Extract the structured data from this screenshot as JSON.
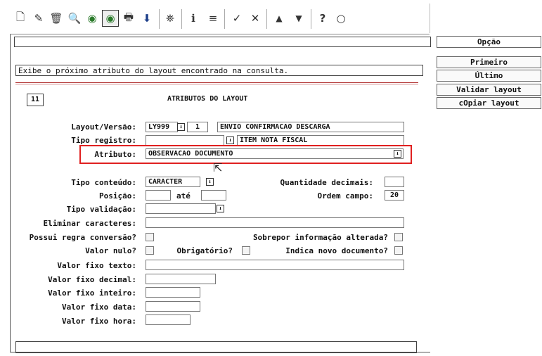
{
  "toolbar": {
    "buttons": [
      {
        "name": "new-icon",
        "glyph": "🗋"
      },
      {
        "name": "edit-icon",
        "glyph": "✎"
      },
      {
        "name": "delete-icon",
        "glyph": "🗑"
      },
      {
        "name": "search-icon",
        "glyph": "🔍"
      },
      {
        "name": "previous-icon",
        "glyph": "◉"
      },
      {
        "name": "next-icon",
        "glyph": "◉"
      },
      {
        "name": "print-icon",
        "glyph": "🖶"
      },
      {
        "name": "export-icon",
        "glyph": "⬇"
      },
      {
        "name": "binoculars-icon",
        "glyph": "⛯"
      },
      {
        "name": "info-icon",
        "glyph": "ℹ"
      },
      {
        "name": "list-icon",
        "glyph": "≡"
      },
      {
        "name": "confirm-icon",
        "glyph": "✓"
      },
      {
        "name": "cancel-icon",
        "glyph": "✕"
      },
      {
        "name": "up-icon",
        "glyph": "▲"
      },
      {
        "name": "down-icon",
        "glyph": "▼"
      },
      {
        "name": "help-icon",
        "glyph": "?"
      },
      {
        "name": "chat-icon",
        "glyph": "○"
      }
    ]
  },
  "message": "Exibe o próximo atributo do layout encontrado na consulta.",
  "form": {
    "record_number": "11",
    "title": "ATRIBUTOS DO LAYOUT",
    "layout_label": "Layout/Versão:",
    "layout_code": "LY999",
    "layout_version": "1",
    "layout_desc": "ENVIO CONFIRMACAO DESCARGA",
    "tipo_registro_label": "Tipo registro:",
    "tipo_registro_code": "",
    "tipo_registro_desc": "ITEM NOTA FISCAL",
    "atributo_label": "Atributo:",
    "atributo_value": "OBSERVACAO DOCUMENTO",
    "tipo_conteudo_label": "Tipo conteúdo:",
    "tipo_conteudo_value": "CARACTER",
    "quantidade_decimais_label": "Quantidade decimais:",
    "quantidade_decimais_value": "",
    "posicao_label": "Posição:",
    "posicao_from": "",
    "ate_label": "até",
    "posicao_to": "",
    "ordem_campo_label": "Ordem campo:",
    "ordem_campo_value": "20",
    "tipo_validacao_label": "Tipo validação:",
    "tipo_validacao_value": "",
    "eliminar_caracteres_label": "Eliminar caracteres:",
    "eliminar_caracteres_value": "",
    "possui_regra_label": "Possui regra conversão?",
    "sobrepor_label": "Sobrepor informação alterada?",
    "valor_nulo_label": "Valor nulo?",
    "obrigatorio_label": "Obrigatório?",
    "indica_novo_label": "Indica novo documento?",
    "valor_fixo_texto_label": "Valor fixo texto:",
    "valor_fixo_decimal_label": "Valor fixo decimal:",
    "valor_fixo_inteiro_label": "Valor fixo inteiro:",
    "valor_fixo_data_label": "Valor fixo data:",
    "valor_fixo_hora_label": "Valor fixo hora:"
  },
  "side": {
    "header": "Opção",
    "buttons": [
      "Primeiro",
      "Último",
      "Validar layout",
      "cOpiar layout"
    ]
  },
  "colors": {
    "highlight": "#e02020",
    "divider": "#b03030"
  }
}
